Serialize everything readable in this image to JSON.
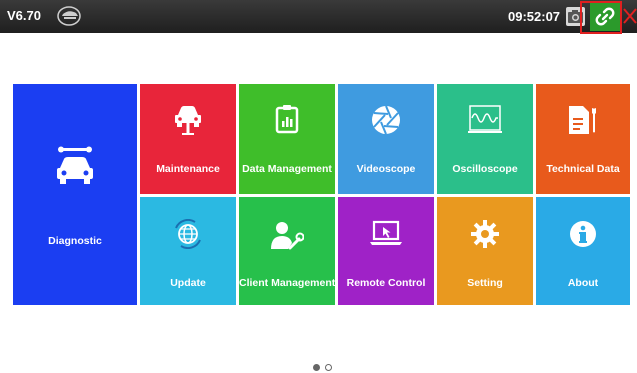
{
  "topbar": {
    "version": "V6.70",
    "logo_icon": "car-brand-logo-icon",
    "time": "09:52:07",
    "camera_icon": "camera-icon",
    "link_icon": "link-icon",
    "close_icon": "close-icon",
    "link_button_color": "#2b9a2b",
    "link_highlight_color": "#e02020"
  },
  "tiles": [
    {
      "id": "diagnostic",
      "label": "Diagnostic",
      "icon": "car-wrench-icon",
      "color": "#1b3ef2"
    },
    {
      "id": "maintenance",
      "label": "Maintenance",
      "icon": "car-lift-icon",
      "color": "#e8253a"
    },
    {
      "id": "data-management",
      "label": "Data Management",
      "icon": "clipboard-chart-icon",
      "color": "#3fbe2a"
    },
    {
      "id": "videoscope",
      "label": "Videoscope",
      "icon": "aperture-icon",
      "color": "#3f9be0"
    },
    {
      "id": "oscilloscope",
      "label": "Oscilloscope",
      "icon": "waveform-icon",
      "color": "#2bbf8a"
    },
    {
      "id": "technical-data",
      "label": "Technical Data",
      "icon": "document-wrench-icon",
      "color": "#e85a1c"
    },
    {
      "id": "update",
      "label": "Update",
      "icon": "globe-refresh-icon",
      "color": "#2bb9e2"
    },
    {
      "id": "client-management",
      "label": "Client Management",
      "icon": "person-wrench-icon",
      "color": "#27c04b"
    },
    {
      "id": "remote-control",
      "label": "Remote Control",
      "icon": "laptop-cursor-icon",
      "color": "#9f22c7"
    },
    {
      "id": "setting",
      "label": "Setting",
      "icon": "gear-icon",
      "color": "#e9991f"
    },
    {
      "id": "about",
      "label": "About",
      "icon": "info-icon",
      "color": "#2aaae6"
    }
  ],
  "pager": {
    "pages": 2,
    "current": 1
  }
}
